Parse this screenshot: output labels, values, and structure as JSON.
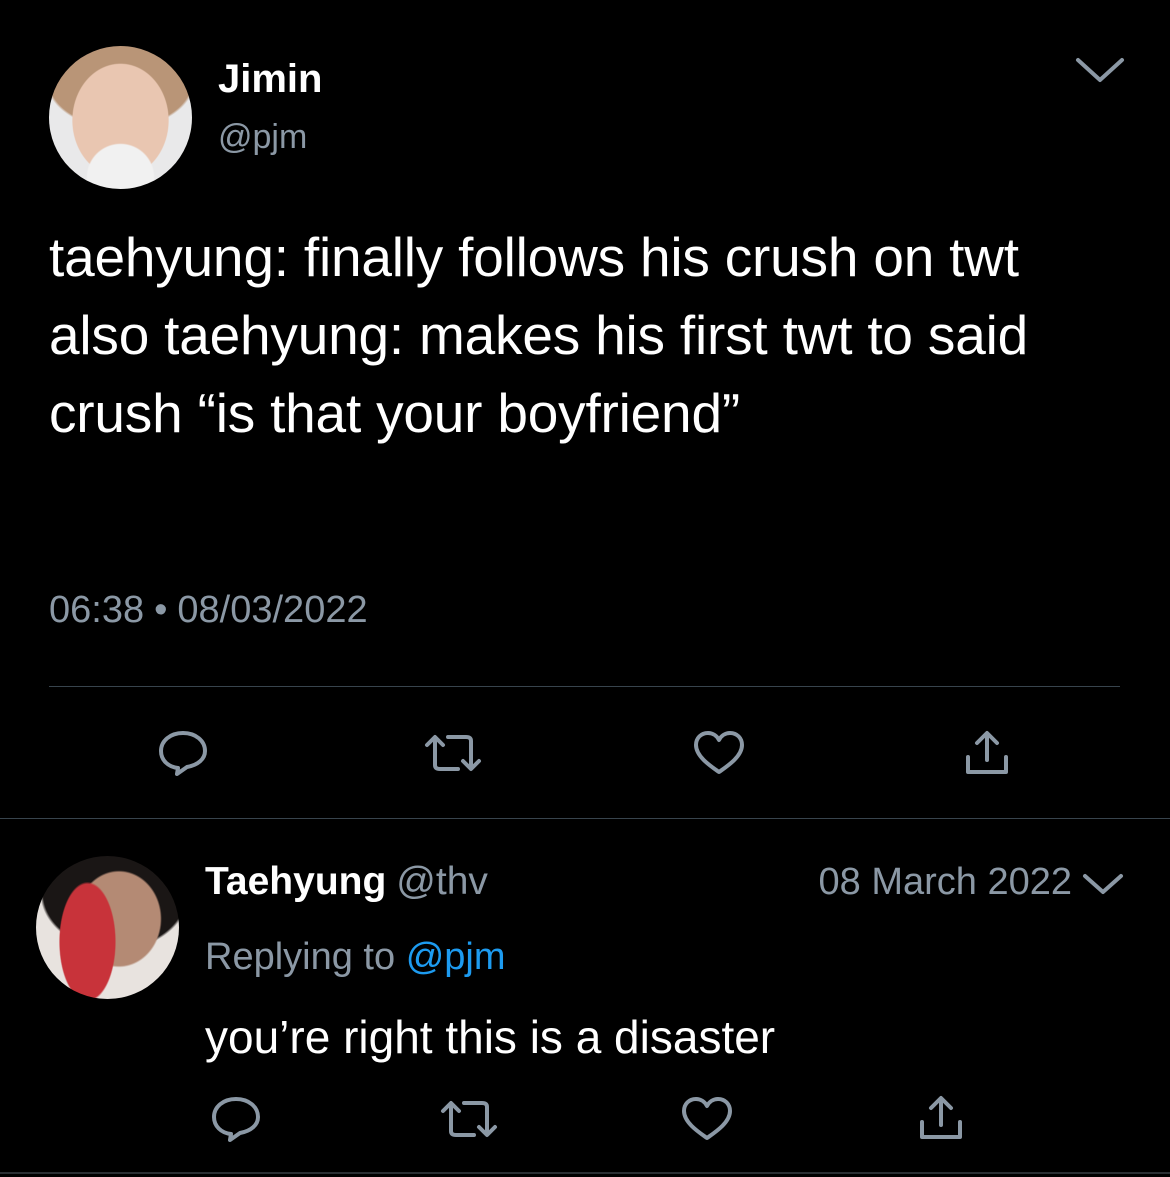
{
  "colors": {
    "background": "#000000",
    "text": "#ffffff",
    "secondary_text": "#8b98a5",
    "link": "#1d9bf0",
    "divider": "#38444d"
  },
  "main_tweet": {
    "display_name": "Jimin",
    "handle": "@pjm",
    "body": "taehyung: finally follows his crush on twt\nalso taehyung: makes his first twt to said crush “is that your boyfriend”",
    "time": "06:38",
    "separator": "•",
    "date": "08/03/2022",
    "actions": [
      {
        "name": "reply",
        "icon": "speech-bubble-icon"
      },
      {
        "name": "retweet",
        "icon": "retweet-icon"
      },
      {
        "name": "like",
        "icon": "heart-icon"
      },
      {
        "name": "share",
        "icon": "share-icon"
      }
    ]
  },
  "reply_tweet": {
    "display_name": "Taehyung",
    "handle": "@thv",
    "date": "08 March 2022",
    "replying_to_label": "Replying to",
    "replying_to_handle": "@pjm",
    "body": "you’re right this is a disaster",
    "actions": [
      {
        "name": "reply",
        "icon": "speech-bubble-icon"
      },
      {
        "name": "retweet",
        "icon": "retweet-icon"
      },
      {
        "name": "like",
        "icon": "heart-icon"
      },
      {
        "name": "share",
        "icon": "share-icon"
      }
    ]
  }
}
